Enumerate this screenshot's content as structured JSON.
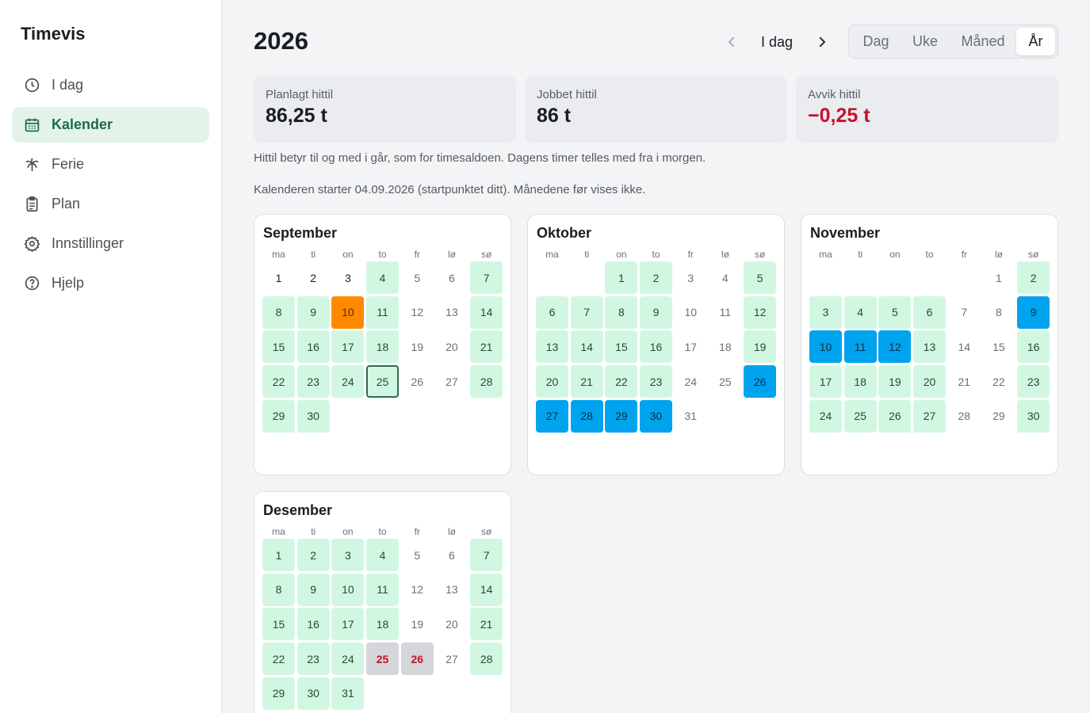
{
  "app": {
    "title": "Timevis"
  },
  "sidebar": {
    "items": [
      {
        "label": "I dag",
        "icon": "clock-icon",
        "active": false
      },
      {
        "label": "Kalender",
        "icon": "calendar-icon",
        "active": true
      },
      {
        "label": "Ferie",
        "icon": "palm-tree-icon",
        "active": false
      },
      {
        "label": "Plan",
        "icon": "clipboard-icon",
        "active": false
      },
      {
        "label": "Innstillinger",
        "icon": "gear-icon",
        "active": false
      },
      {
        "label": "Hjelp",
        "icon": "help-circle-icon",
        "active": false
      }
    ]
  },
  "header": {
    "year": "2026",
    "today_label": "I dag",
    "views": [
      "Dag",
      "Uke",
      "Måned",
      "År"
    ],
    "active_view": "År"
  },
  "stats": [
    {
      "label": "Planlagt hittil",
      "value": "86,25 t",
      "negative": false
    },
    {
      "label": "Jobbet hittil",
      "value": "86 t",
      "negative": false
    },
    {
      "label": "Avvik hittil",
      "value": "−0,25 t",
      "negative": true
    }
  ],
  "notes": [
    "Hittil betyr til og med i går, som for timesaldoen. Dagens timer telles med fra i morgen.",
    "Kalenderen starter 04.09.2026 (startpunktet ditt). Månedene før vises ikke."
  ],
  "weekdays": [
    "ma",
    "ti",
    "on",
    "to",
    "fr",
    "lø",
    "sø"
  ],
  "colors": {
    "accent": "#1f6b47",
    "work": "#d1f7e2",
    "sick": "#ff8a00",
    "vacation": "#00a3ee",
    "holiday": "#d4d6da",
    "negative": "#c8102e"
  },
  "months": [
    {
      "name": "September",
      "offset": 1,
      "days": 30,
      "status": {
        "1": "plain",
        "2": "plain",
        "3": "plain",
        "4": "work",
        "5": "weekend",
        "6": "weekend",
        "7": "work",
        "8": "work",
        "9": "work",
        "10": "sick",
        "11": "work",
        "12": "weekend",
        "13": "weekend",
        "14": "work",
        "15": "work",
        "16": "work",
        "17": "work",
        "18": "work",
        "19": "weekend",
        "20": "weekend",
        "21": "work",
        "22": "work",
        "23": "work",
        "24": "work",
        "25": "today",
        "26": "weekend",
        "27": "weekend",
        "28": "work",
        "29": "work",
        "30": "work"
      }
    },
    {
      "name": "Oktober",
      "offset": 3,
      "days": 31,
      "status": {
        "1": "work",
        "2": "work",
        "3": "weekend",
        "4": "weekend",
        "5": "work",
        "6": "work",
        "7": "work",
        "8": "work",
        "9": "work",
        "10": "weekend",
        "11": "weekend",
        "12": "work",
        "13": "work",
        "14": "work",
        "15": "work",
        "16": "work",
        "17": "weekend",
        "18": "weekend",
        "19": "work",
        "20": "work",
        "21": "work",
        "22": "work",
        "23": "work",
        "24": "weekend",
        "25": "weekend",
        "26": "vac",
        "27": "vac",
        "28": "vac",
        "29": "vac",
        "30": "vac",
        "31": "weekend"
      }
    },
    {
      "name": "November",
      "offset": 6,
      "days": 30,
      "status": {
        "1": "weekend",
        "2": "work",
        "3": "work",
        "4": "work",
        "5": "work",
        "6": "work",
        "7": "weekend",
        "8": "weekend",
        "9": "vac",
        "10": "vac",
        "11": "vac",
        "12": "vac",
        "13": "work",
        "14": "weekend",
        "15": "weekend",
        "16": "work",
        "17": "work",
        "18": "work",
        "19": "work",
        "20": "work",
        "21": "weekend",
        "22": "weekend",
        "23": "work",
        "24": "work",
        "25": "work",
        "26": "work",
        "27": "work",
        "28": "weekend",
        "29": "weekend",
        "30": "work"
      }
    },
    {
      "name": "Desember",
      "offset": 1,
      "days": 31,
      "status": {
        "1": "work",
        "2": "work",
        "3": "work",
        "4": "work",
        "5": "weekend",
        "6": "weekend",
        "7": "work",
        "8": "work",
        "9": "work",
        "10": "work",
        "11": "work",
        "12": "weekend",
        "13": "weekend",
        "14": "work",
        "15": "work",
        "16": "work",
        "17": "work",
        "18": "work",
        "19": "weekend",
        "20": "weekend",
        "21": "work",
        "22": "work",
        "23": "work",
        "24": "work",
        "25": "holiday",
        "26": "holiday",
        "27": "weekend",
        "28": "work",
        "29": "work",
        "30": "work",
        "31": "work"
      }
    }
  ]
}
